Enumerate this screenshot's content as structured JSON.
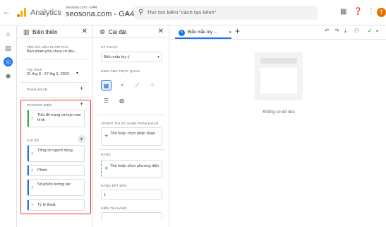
{
  "topbar": {
    "back_icon": "←",
    "app_name": "Analytics",
    "account_small": "seosona.com - GA4",
    "account_main": "seosona.com - GA4",
    "search_placeholder": "Thử tìm kiếm \"cách tạo kênh\"",
    "accent_color": "#e37400",
    "avatar_letter": "T"
  },
  "variables_panel": {
    "title": "Biến thiên",
    "exploration_name_label": "TÊN DỮ LIỆU KHÁM PHÁ:",
    "exploration_name": "Bản khám phá chưa có tiêu...",
    "date_label": "Tùy chỉnh",
    "date_range": "31 thg 8 - 27 thg 9, 2023",
    "segments_label": "PHÂN ĐOẠN",
    "dimensions_label": "PHƯƠNG DIỆN",
    "dimensions": [
      "Tiêu đề trang và loại màn hình"
    ],
    "metrics_label": "CHỈ SỐ",
    "metrics": [
      "Tổng số người dùng",
      "Phiên",
      "Số phiên tương tác",
      "Tỷ lệ thoát"
    ]
  },
  "settings_panel": {
    "title": "Cài đặt",
    "technique_label": "KỸ THUẬT",
    "technique_value": "Biểu mẫu tùy ý",
    "visualization_label": "HÌNH ẢNH TRỰC QUAN",
    "segment_compare_label": "THÔNG TIN SO SÁNH PHÂN ĐOẠN",
    "segment_drop": "Thả hoặc chọn phân đoạn",
    "rows_label": "HÀNG",
    "rows_drop": "Thả hoặc chọn phương diện",
    "start_row_label": "HÀNG BẮT ĐẦU",
    "start_row_value": "1",
    "show_rows_label": "HIỂN THỊ HÀNG"
  },
  "canvas": {
    "tab_label": "Biểu mẫu tùy ...",
    "empty_text": "Không có dữ liệu"
  }
}
